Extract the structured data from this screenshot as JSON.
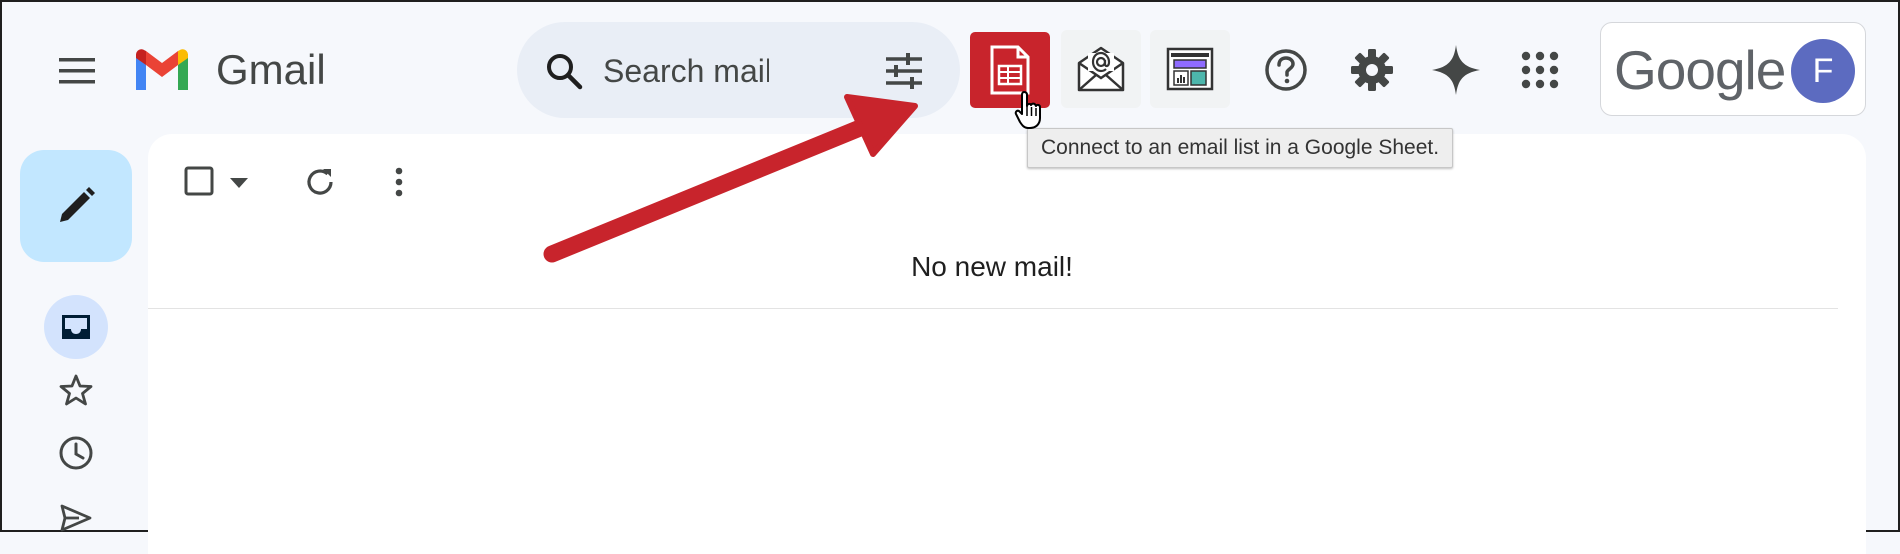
{
  "header": {
    "brand": "Gmail",
    "search_placeholder": "Search mail",
    "tooltip": "Connect to an email list in a Google Sheet.",
    "google_word": "Google",
    "avatar_letter": "F"
  },
  "main": {
    "empty_message": "No new mail!"
  },
  "icons": {
    "menu": "hamburger-menu-icon",
    "search": "search-icon",
    "filter": "filter-options-icon",
    "sheet_addon": "google-sheet-icon",
    "mail_addon": "mail-at-envelope-icon",
    "layout_addon": "template-layout-icon",
    "help": "help-icon",
    "settings": "gear-icon",
    "gemini": "sparkle-icon",
    "apps": "apps-grid-icon",
    "compose": "pencil-icon",
    "inbox": "inbox-icon",
    "starred": "star-icon",
    "snoozed": "clock-icon",
    "sent": "send-icon"
  },
  "colors": {
    "sheet_addon_bg": "#c8242c",
    "compose_bg": "#c2e7ff",
    "avatar_bg": "#5c6bc0",
    "annotation_arrow": "#c8242c"
  }
}
